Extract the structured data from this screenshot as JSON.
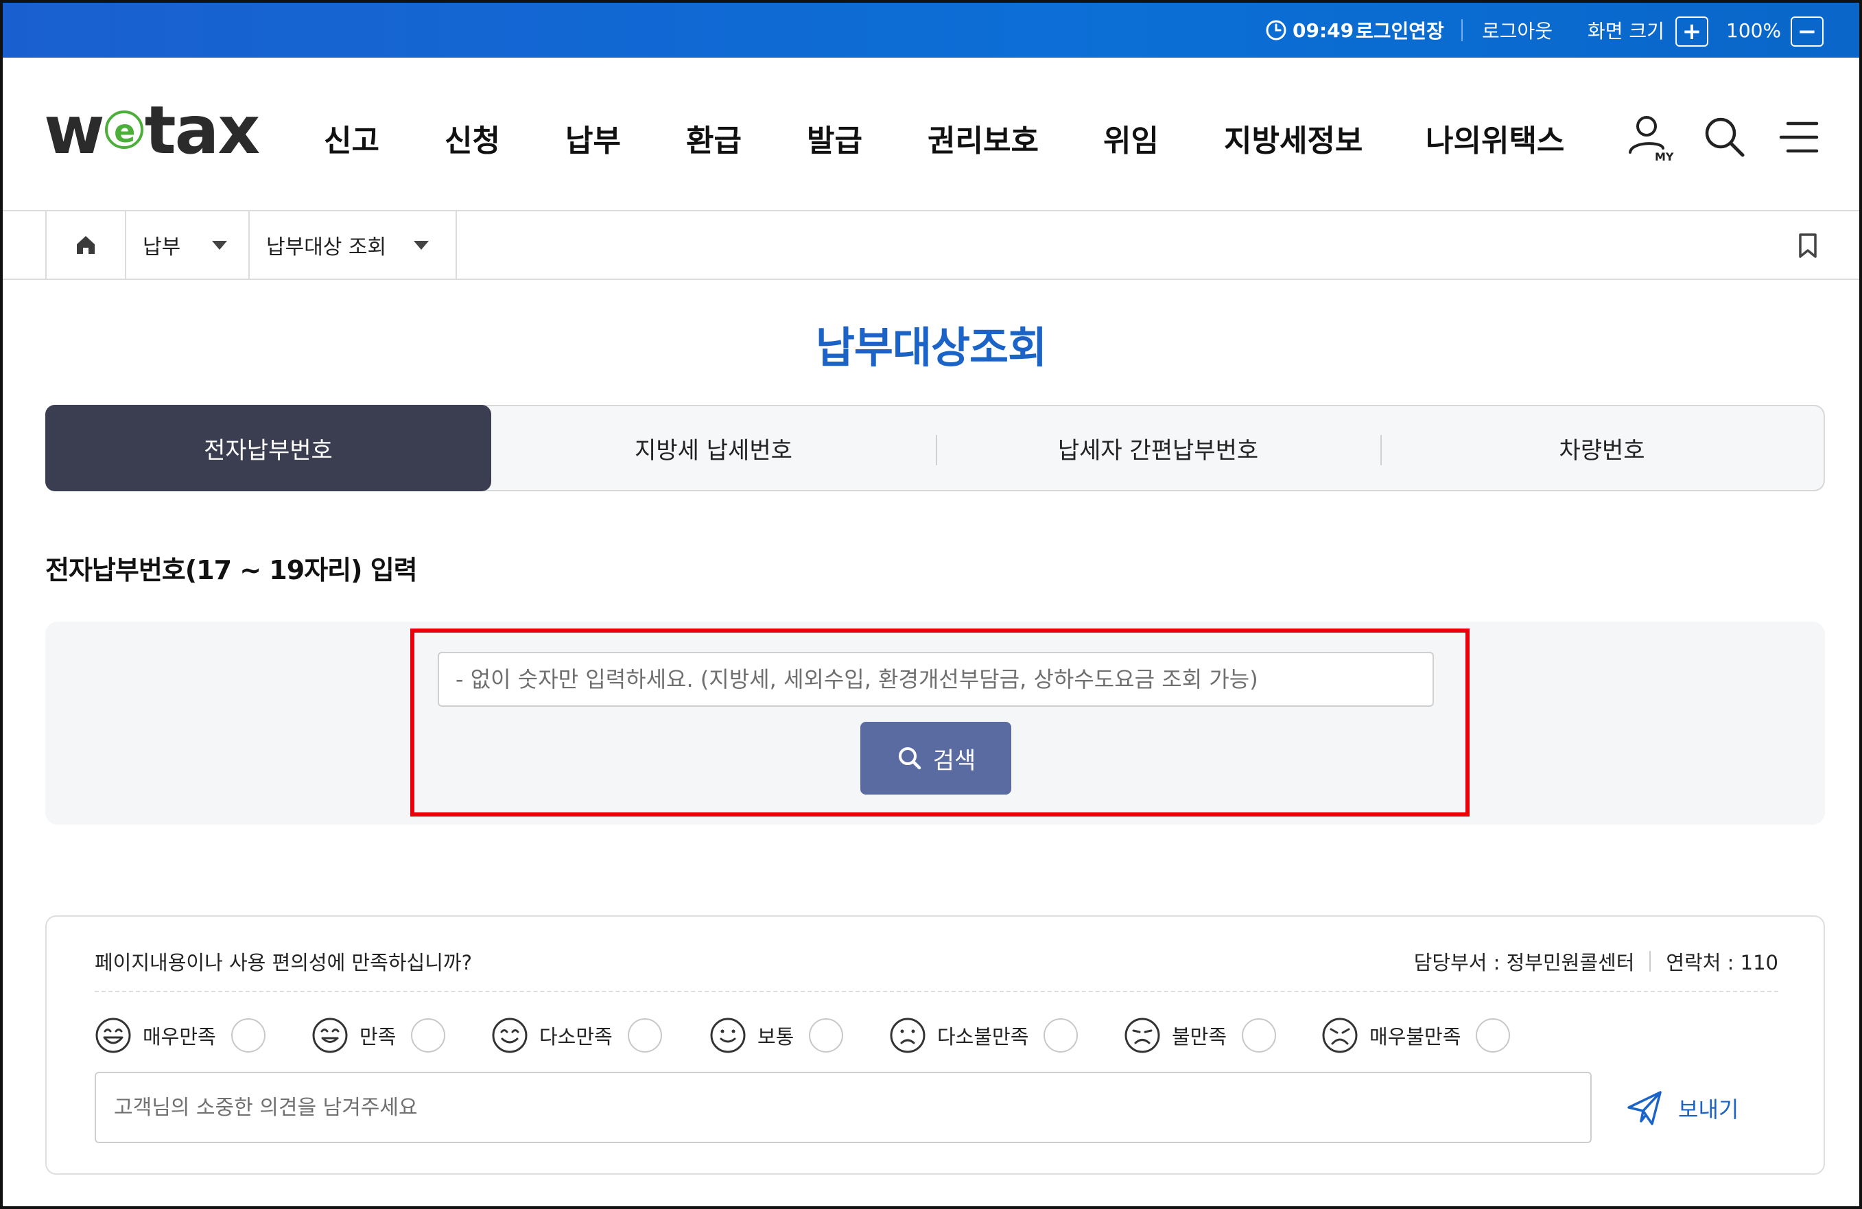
{
  "topbar": {
    "time": "09:49",
    "extend_login": "로그인연장",
    "logout": "로그아웃",
    "screen_size_label": "화면 크기",
    "zoom_in": "+",
    "zoom_level": "100%",
    "zoom_out": "−"
  },
  "header": {
    "logo": {
      "pre": "w",
      "circle": "e",
      "post": "tax"
    },
    "nav": [
      "신고",
      "신청",
      "납부",
      "환급",
      "발급",
      "권리보호",
      "위임",
      "지방세정보",
      "나의위택스"
    ],
    "my_icon_label": "MY"
  },
  "breadcrumb": {
    "level1": "납부",
    "level2": "납부대상 조회"
  },
  "page": {
    "title": "납부대상조회",
    "tabs": [
      "전자납부번호",
      "지방세 납세번호",
      "납세자 간편납부번호",
      "차량번호"
    ],
    "active_tab": 0,
    "section_title": "전자납부번호(17 ~ 19자리) 입력",
    "search_placeholder": "- 없이 숫자만 입력하세요. (지방세, 세외수입, 환경개선부담금, 상하수도요금 조회 가능)",
    "search_button": "검색"
  },
  "feedback": {
    "question": "페이지내용이나 사용 편의성에 만족하십니까?",
    "department": "담당부서 : 정부민원콜센터",
    "contact": "연락처 : 110",
    "ratings": [
      "매우만족",
      "만족",
      "다소만족",
      "보통",
      "다소불만족",
      "불만족",
      "매우불만족"
    ],
    "comment_placeholder": "고객님의 소중한 의견을 남겨주세요",
    "send_button": "보내기"
  },
  "colors": {
    "topbar_blue": "#0b6fd6",
    "title_blue": "#1b63c6",
    "active_tab": "#3b3d50",
    "search_button": "#5a6ba1",
    "highlight_red": "#e8000b",
    "logo_green": "#4caf3a"
  }
}
